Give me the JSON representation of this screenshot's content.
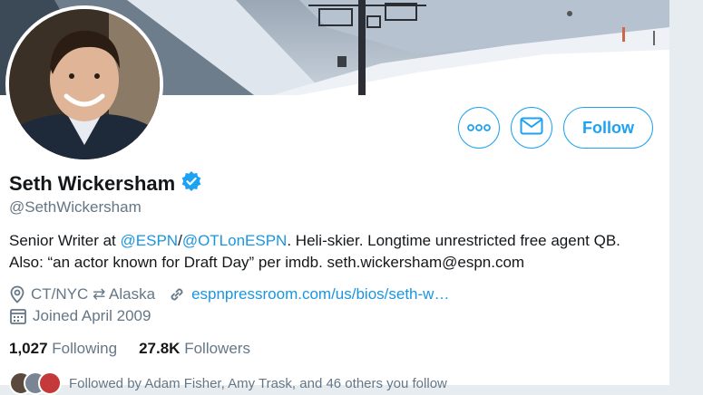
{
  "profile": {
    "display_name": "Seth Wickersham",
    "handle": "@SethWickersham",
    "verified": true
  },
  "bio": {
    "prefix": "Senior Writer at ",
    "mention1": "@ESPN",
    "separator": "/",
    "mention2": "@OTLonESPN",
    "suffix": ". Heli-skier. Longtime unrestricted free agent QB. Also: “an actor known for Draft Day” per imdb. seth.wickersham@espn.com"
  },
  "meta": {
    "location": "CT/NYC ⇄ Alaska",
    "website": "espnpressroom.com/us/bios/seth-w…",
    "joined": "Joined April 2009"
  },
  "stats": {
    "following_count": "1,027",
    "following_label": "Following",
    "followers_count": "27.8K",
    "followers_label": "Followers"
  },
  "followed_by": "Followed by Adam Fisher, Amy Trask, and 46 others you follow",
  "actions": {
    "more_icon": "more-icon",
    "message_icon": "mail-icon",
    "follow_label": "Follow"
  },
  "colors": {
    "accent": "#1da1f2",
    "link": "#1b95e0",
    "muted": "#657786",
    "text": "#14171a"
  }
}
